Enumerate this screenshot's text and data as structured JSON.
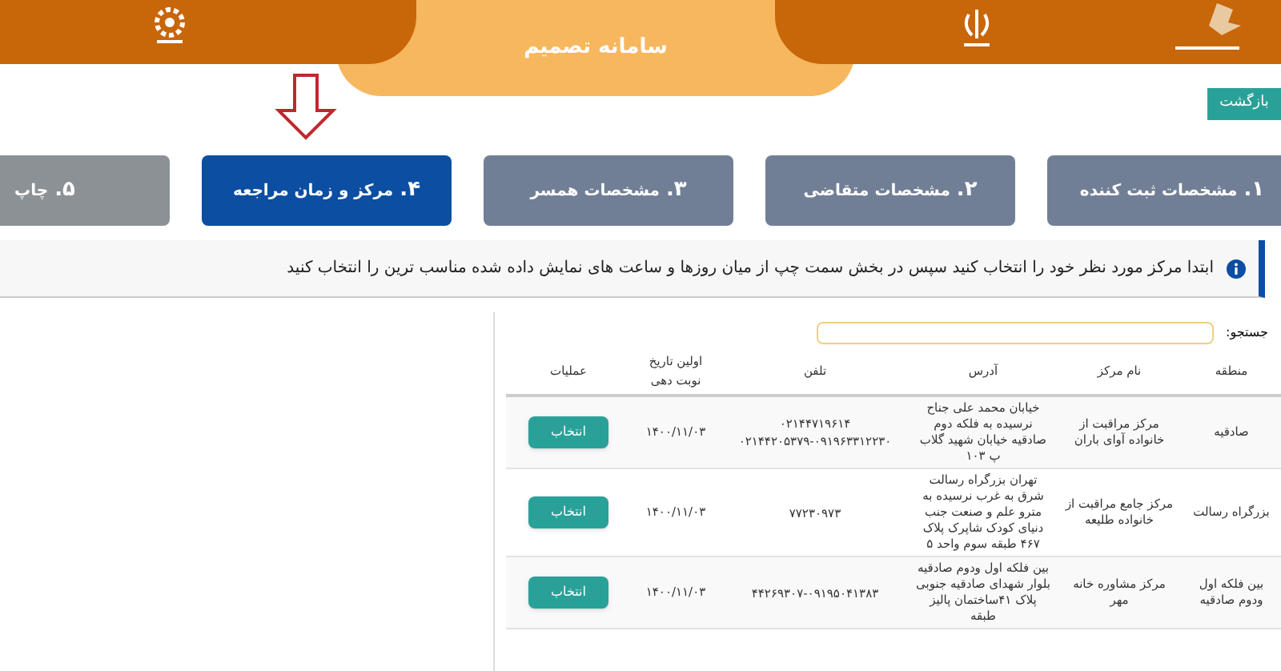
{
  "header": {
    "title": "سامانه تصمیم"
  },
  "back_button": "بازگشت",
  "steps": [
    {
      "number": "۱.",
      "label": "مشخصات ثبت کننده",
      "selected": false
    },
    {
      "number": "۲.",
      "label": "مشخصات متقاضی",
      "selected": false
    },
    {
      "number": "۳.",
      "label": "مشخصات همسر",
      "selected": false
    },
    {
      "number": "۴.",
      "label": "مرکز و زمان مراجعه",
      "selected": true
    },
    {
      "number": "۵.",
      "label": "چاپ",
      "selected": false
    }
  ],
  "info": "ابتدا مرکز مورد نظر خود را انتخاب کنید سپس در بخش سمت چپ از میان روزها و ساعت های نمایش داده شده مناسب ترین را انتخاب کنید",
  "search": {
    "label": "جستجو:"
  },
  "table": {
    "columns": [
      "منطقه",
      "نام مرکز",
      "آدرس",
      "تلفن",
      "اولین تاریخ نوبت دهی",
      "عملیات"
    ],
    "rows": [
      {
        "region": "صادقیه",
        "center": "مرکز مراقبت از خانواده آوای باران",
        "address": "خیابان محمد علی جناح نرسیده به فلکه دوم صادقیه خیابان شهید گلاب پ ۱۰۳",
        "phones": [
          "۰۲۱۴۴۷۱۹۶۱۴",
          "۰۲۱۴۴۲۰۵۳۷۹-۰۹۱۹۶۳۳۱۲۲۳۰"
        ],
        "date": "۱۴۰۰/۱۱/۰۳",
        "action": "انتخاب"
      },
      {
        "region": "بزرگراه رسالت",
        "center": "مرکز جامع مراقبت از خانواده طلیعه",
        "address": "تهران بزرگراه رسالت شرق به غرب نرسیده به مترو علم و صنعت جنب دنیای کودک شاپرک پلاک ۴۶۷ طبقه سوم واحد ۵",
        "phones": [
          "۷۷۲۳۰۹۷۳"
        ],
        "date": "۱۴۰۰/۱۱/۰۳",
        "action": "انتخاب"
      },
      {
        "region": "بین فلکه اول ودوم صادقیه",
        "center": "مرکز مشاوره خانه مهر",
        "address": "بین فلکه اول ودوم صادقیه بلوار شهدای صادقیه جنوبی پلاک ۴۱ساختمان پالیز طبقه",
        "phones": [
          "۴۴۲۶۹۳۰۷-۰۹۱۹۵۰۴۱۳۸۳"
        ],
        "date": "۱۴۰۰/۱۱/۰۳",
        "action": "انتخاب"
      }
    ]
  }
}
